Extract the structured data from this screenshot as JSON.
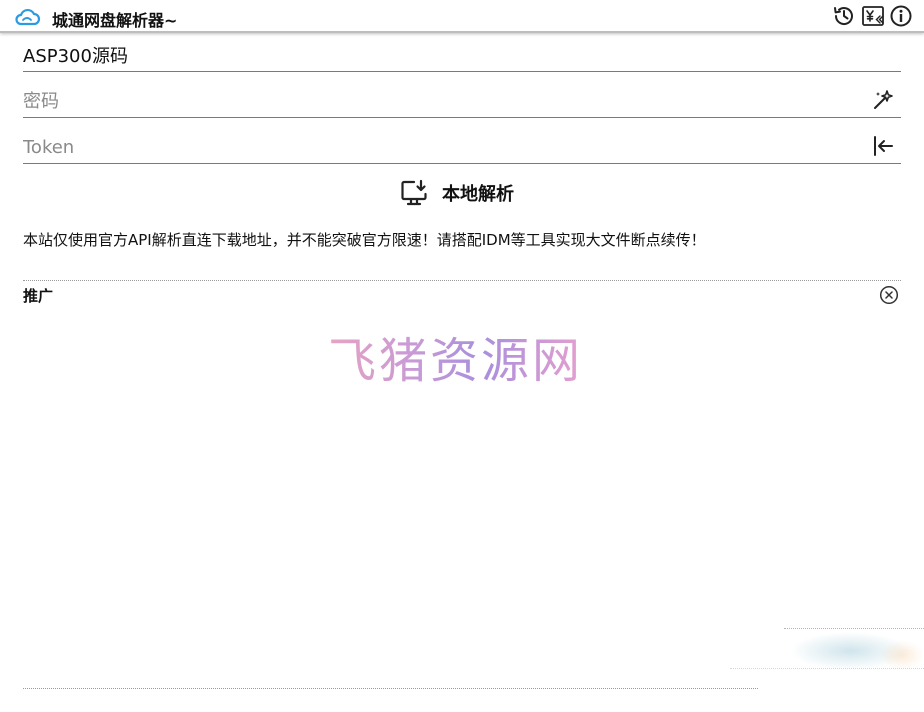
{
  "titlebar": {
    "app_title": "城通网盘解析器~",
    "logo_icon": "cloud-icon",
    "buttons": [
      {
        "name": "history-icon"
      },
      {
        "name": "donate-icon"
      },
      {
        "name": "info-icon"
      }
    ]
  },
  "form": {
    "share_link": {
      "value": "ASP300源码",
      "placeholder": ""
    },
    "password": {
      "value": "",
      "placeholder": "密码",
      "icon": "magic-wand-icon"
    },
    "token": {
      "value": "",
      "placeholder": "Token",
      "icon": "login-icon"
    }
  },
  "actions": {
    "parse_label": "本地解析",
    "parse_icon": "monitor-download-icon"
  },
  "notice": "本站仅使用官方API解析直连下载地址，并不能突破官方限速！请搭配IDM等工具实现大文件断点续传！",
  "promo": {
    "label": "推广",
    "close_icon": "close-circle-icon",
    "brand_text": "飞猪资源网"
  }
}
